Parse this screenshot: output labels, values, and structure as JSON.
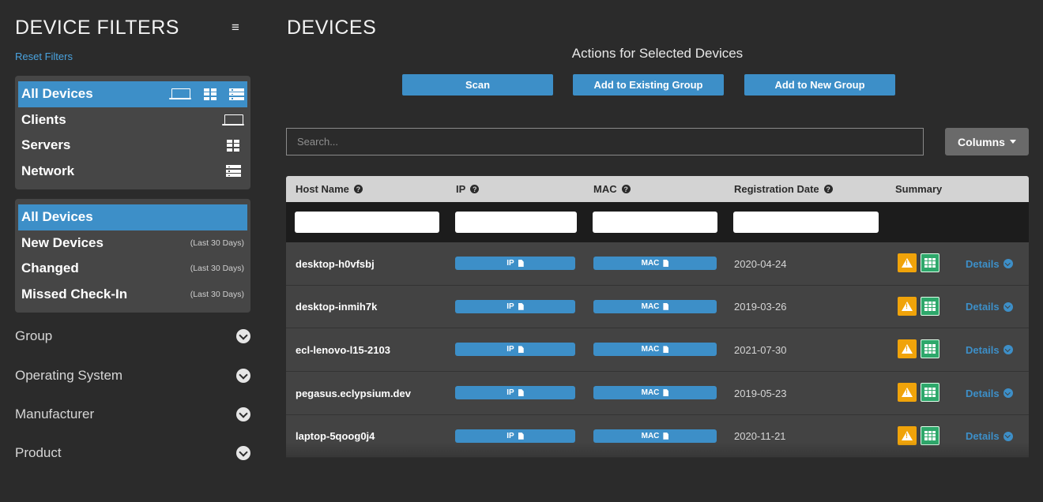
{
  "sidebar": {
    "title": "DEVICE FILTERS",
    "menu_icon": "≡",
    "reset_label": "Reset Filters",
    "device_types": [
      {
        "label": "All Devices",
        "icons": [
          "laptop-icon",
          "server-icon",
          "network-icon"
        ],
        "active": true
      },
      {
        "label": "Clients",
        "icons": [
          "laptop-icon"
        ],
        "active": false
      },
      {
        "label": "Servers",
        "icons": [
          "server-icon"
        ],
        "active": false
      },
      {
        "label": "Network",
        "icons": [
          "network-icon"
        ],
        "active": false
      }
    ],
    "time_filters": [
      {
        "label": "All Devices",
        "note": "",
        "active": true
      },
      {
        "label": "New Devices",
        "note": "(Last 30 Days)",
        "active": false
      },
      {
        "label": "Changed",
        "note": "(Last 30 Days)",
        "active": false
      },
      {
        "label": "Missed Check-In",
        "note": "(Last 30 Days)",
        "active": false
      }
    ],
    "sections": [
      "Group",
      "Operating System",
      "Manufacturer",
      "Product"
    ]
  },
  "main": {
    "title": "DEVICES",
    "actions_title": "Actions for Selected Devices",
    "actions": [
      "Scan",
      "Add to Existing Group",
      "Add to New Group"
    ],
    "search_placeholder": "Search...",
    "columns_label": "Columns",
    "table": {
      "headers": [
        "Host Name",
        "IP",
        "MAC",
        "Registration Date",
        "Summary"
      ],
      "help_icon": "?",
      "rows": [
        {
          "host": "desktop-h0vfsbj",
          "ip": "IP",
          "mac": "MAC",
          "date": "2020-04-24",
          "details": "Details"
        },
        {
          "host": "desktop-inmih7k",
          "ip": "IP",
          "mac": "MAC",
          "date": "2019-03-26",
          "details": "Details"
        },
        {
          "host": "ecl-lenovo-l15-2103",
          "ip": "IP",
          "mac": "MAC",
          "date": "2021-07-30",
          "details": "Details"
        },
        {
          "host": "pegasus.eclypsium.dev",
          "ip": "IP",
          "mac": "MAC",
          "date": "2019-05-23",
          "details": "Details"
        },
        {
          "host": "laptop-5qoog0j4",
          "ip": "IP",
          "mac": "MAC",
          "date": "2020-11-21",
          "details": "Details"
        }
      ]
    }
  },
  "colors": {
    "background": "#2b2b2b",
    "panel": "#464646",
    "accent": "#3d8fc8",
    "warning": "#f0a30a",
    "success": "#2ea86b",
    "table_header": "#d3d3d3"
  }
}
